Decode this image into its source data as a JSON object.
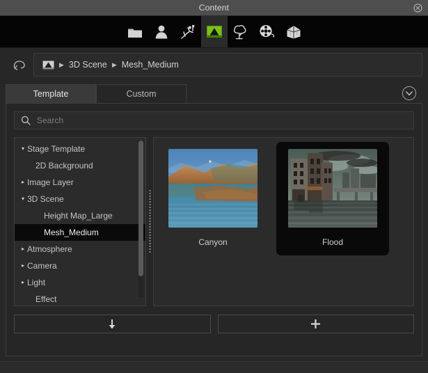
{
  "window": {
    "title": "Content",
    "close_icon": "close-circle-icon"
  },
  "toolbar": {
    "items": [
      {
        "icon": "folder-icon",
        "name": "folder",
        "active": false
      },
      {
        "icon": "person-icon",
        "name": "character",
        "active": false
      },
      {
        "icon": "motion-icon",
        "name": "motion",
        "active": false
      },
      {
        "icon": "stage-icon",
        "name": "stage",
        "active": true
      },
      {
        "icon": "tree-icon",
        "name": "scene-object",
        "active": false
      },
      {
        "icon": "film-reel-icon",
        "name": "media",
        "active": false
      },
      {
        "icon": "prop-umbrella-icon",
        "name": "prop",
        "active": false
      }
    ]
  },
  "breadcrumb": {
    "back_icon": "back-arrow-icon",
    "root_icon": "stage-icon",
    "separator": "▶",
    "items": [
      "3D Scene",
      "Mesh_Medium"
    ]
  },
  "tabs": {
    "items": [
      {
        "label": "Template",
        "active": true
      },
      {
        "label": "Custom",
        "active": false
      }
    ],
    "collapse_icon": "chevron-down-circle-icon"
  },
  "search": {
    "icon": "search-icon",
    "placeholder": "Search",
    "value": ""
  },
  "tree": {
    "items": [
      {
        "label": "Stage Template",
        "depth": 0,
        "twisty": "▾",
        "selected": false
      },
      {
        "label": "2D Background",
        "depth": 1,
        "twisty": "",
        "selected": false
      },
      {
        "label": "Image Layer",
        "depth": 0,
        "twisty": "▸",
        "selected": false
      },
      {
        "label": "3D Scene",
        "depth": 0,
        "twisty": "▾",
        "selected": false
      },
      {
        "label": "Height Map_Large",
        "depth": 1,
        "twisty": "",
        "selected": false
      },
      {
        "label": "Mesh_Medium",
        "depth": 1,
        "twisty": "",
        "selected": true
      },
      {
        "label": "Atmosphere",
        "depth": 0,
        "twisty": "▸",
        "selected": false
      },
      {
        "label": "Camera",
        "depth": 0,
        "twisty": "▸",
        "selected": false
      },
      {
        "label": "Light",
        "depth": 0,
        "twisty": "▸",
        "selected": false
      },
      {
        "label": "Effect",
        "depth": 1,
        "twisty": "",
        "selected": false
      }
    ]
  },
  "thumbnails": {
    "items": [
      {
        "label": "Canyon",
        "selected": false,
        "kind": "canyon-landscape"
      },
      {
        "label": "Flood",
        "selected": true,
        "kind": "flooded-city"
      }
    ]
  },
  "bottom_buttons": [
    {
      "name": "download-button",
      "icon": "down-arrow-icon"
    },
    {
      "name": "add-button",
      "icon": "plus-icon"
    }
  ],
  "colors": {
    "accent_green": "#7ac11c",
    "window_bg": "#272727",
    "titlebar_bg": "#4e4e4e",
    "toolbar_bg": "#050505",
    "selection_bg": "#0a0a0a",
    "text": "#c9c9c9"
  }
}
